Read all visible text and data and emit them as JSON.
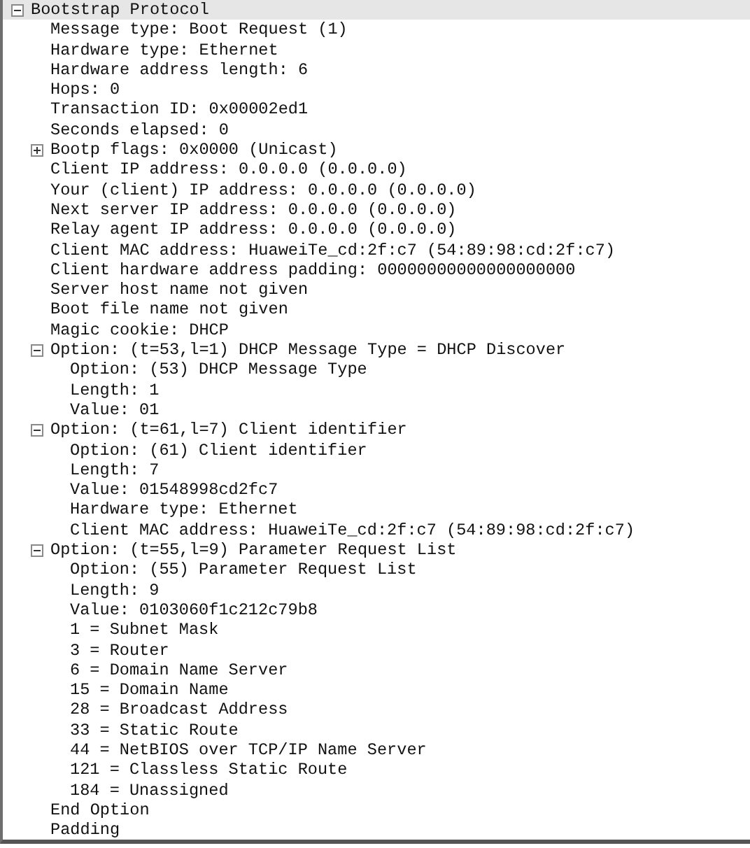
{
  "tree": [
    {
      "label": "Bootstrap Protocol",
      "selected": true,
      "expanded": true,
      "children": [
        {
          "label": "Message type: Boot Request (1)"
        },
        {
          "label": "Hardware type: Ethernet"
        },
        {
          "label": "Hardware address length: 6"
        },
        {
          "label": "Hops: 0"
        },
        {
          "label": "Transaction ID: 0x00002ed1"
        },
        {
          "label": "Seconds elapsed: 0"
        },
        {
          "label": "Bootp flags: 0x0000 (Unicast)",
          "expanded": false
        },
        {
          "label": "Client IP address: 0.0.0.0 (0.0.0.0)"
        },
        {
          "label": "Your (client) IP address: 0.0.0.0 (0.0.0.0)"
        },
        {
          "label": "Next server IP address: 0.0.0.0 (0.0.0.0)"
        },
        {
          "label": "Relay agent IP address: 0.0.0.0 (0.0.0.0)"
        },
        {
          "label": "Client MAC address: HuaweiTe_cd:2f:c7 (54:89:98:cd:2f:c7)"
        },
        {
          "label": "Client hardware address padding: 00000000000000000000"
        },
        {
          "label": "Server host name not given"
        },
        {
          "label": "Boot file name not given"
        },
        {
          "label": "Magic cookie: DHCP"
        },
        {
          "label": "Option: (t=53,l=1) DHCP Message Type = DHCP Discover",
          "expanded": true,
          "children": [
            {
              "label": "Option: (53) DHCP Message Type"
            },
            {
              "label": "Length: 1"
            },
            {
              "label": "Value: 01"
            }
          ]
        },
        {
          "label": "Option: (t=61,l=7) Client identifier",
          "expanded": true,
          "children": [
            {
              "label": "Option: (61) Client identifier"
            },
            {
              "label": "Length: 7"
            },
            {
              "label": "Value: 01548998cd2fc7"
            },
            {
              "label": "Hardware type: Ethernet"
            },
            {
              "label": "Client MAC address: HuaweiTe_cd:2f:c7 (54:89:98:cd:2f:c7)"
            }
          ]
        },
        {
          "label": "Option: (t=55,l=9) Parameter Request List",
          "expanded": true,
          "children": [
            {
              "label": "Option: (55) Parameter Request List"
            },
            {
              "label": "Length: 9"
            },
            {
              "label": "Value: 0103060f1c212c79b8"
            },
            {
              "label": "1 = Subnet Mask"
            },
            {
              "label": "3 = Router"
            },
            {
              "label": "6 = Domain Name Server"
            },
            {
              "label": "15 = Domain Name"
            },
            {
              "label": "28 = Broadcast Address"
            },
            {
              "label": "33 = Static Route"
            },
            {
              "label": "44 = NetBIOS over TCP/IP Name Server"
            },
            {
              "label": "121 = Classless Static Route"
            },
            {
              "label": "184 = Unassigned"
            }
          ]
        },
        {
          "label": "End Option"
        },
        {
          "label": "Padding"
        }
      ]
    }
  ]
}
